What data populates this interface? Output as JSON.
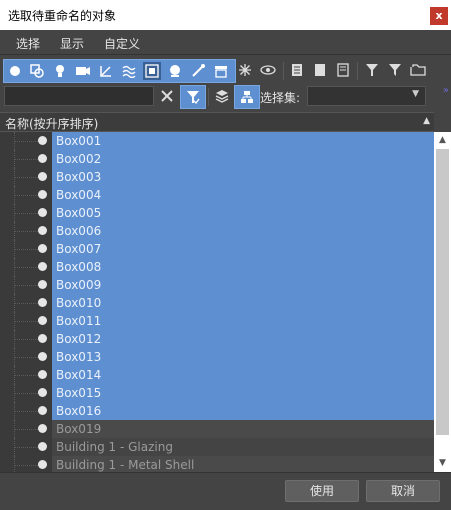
{
  "window": {
    "title": "选取待重命名的对象",
    "close_label": "x"
  },
  "menu": {
    "items": [
      "选择",
      "显示",
      "自定义"
    ]
  },
  "toolbar": {
    "type_filters": [
      "geometry-icon",
      "shapes-icon",
      "lights-icon",
      "cameras-icon",
      "helpers-icon",
      "spacewarps-icon",
      "groups-icon",
      "xrefs-icon",
      "bones-icon",
      "containers-icon"
    ],
    "more_filters": [
      "frozen-icon",
      "hidden-icon",
      "select-all-icon",
      "select-none-icon",
      "invert-icon",
      "filter-icon",
      "filter-funnel-icon",
      "folder-icon"
    ]
  },
  "search": {
    "value": "",
    "placeholder": ""
  },
  "selection_set": {
    "label": "选择集:",
    "value": ""
  },
  "list": {
    "header": "名称(按升序排序)",
    "items": [
      {
        "name": "Box001",
        "selected": true
      },
      {
        "name": "Box002",
        "selected": true
      },
      {
        "name": "Box003",
        "selected": true
      },
      {
        "name": "Box004",
        "selected": true
      },
      {
        "name": "Box005",
        "selected": true
      },
      {
        "name": "Box006",
        "selected": true
      },
      {
        "name": "Box007",
        "selected": true
      },
      {
        "name": "Box008",
        "selected": true
      },
      {
        "name": "Box009",
        "selected": true
      },
      {
        "name": "Box010",
        "selected": true
      },
      {
        "name": "Box011",
        "selected": true
      },
      {
        "name": "Box012",
        "selected": true
      },
      {
        "name": "Box013",
        "selected": true
      },
      {
        "name": "Box014",
        "selected": true
      },
      {
        "name": "Box015",
        "selected": true
      },
      {
        "name": "Box016",
        "selected": true
      },
      {
        "name": "Box019",
        "selected": false
      },
      {
        "name": "Building 1 - Glazing",
        "selected": false
      },
      {
        "name": "Building 1 - Metal Shell",
        "selected": false
      }
    ]
  },
  "buttons": {
    "use": "使用",
    "cancel": "取消"
  },
  "colors": {
    "accent": "#5e8fd0",
    "panel": "#444444",
    "close": "#c0392b"
  }
}
